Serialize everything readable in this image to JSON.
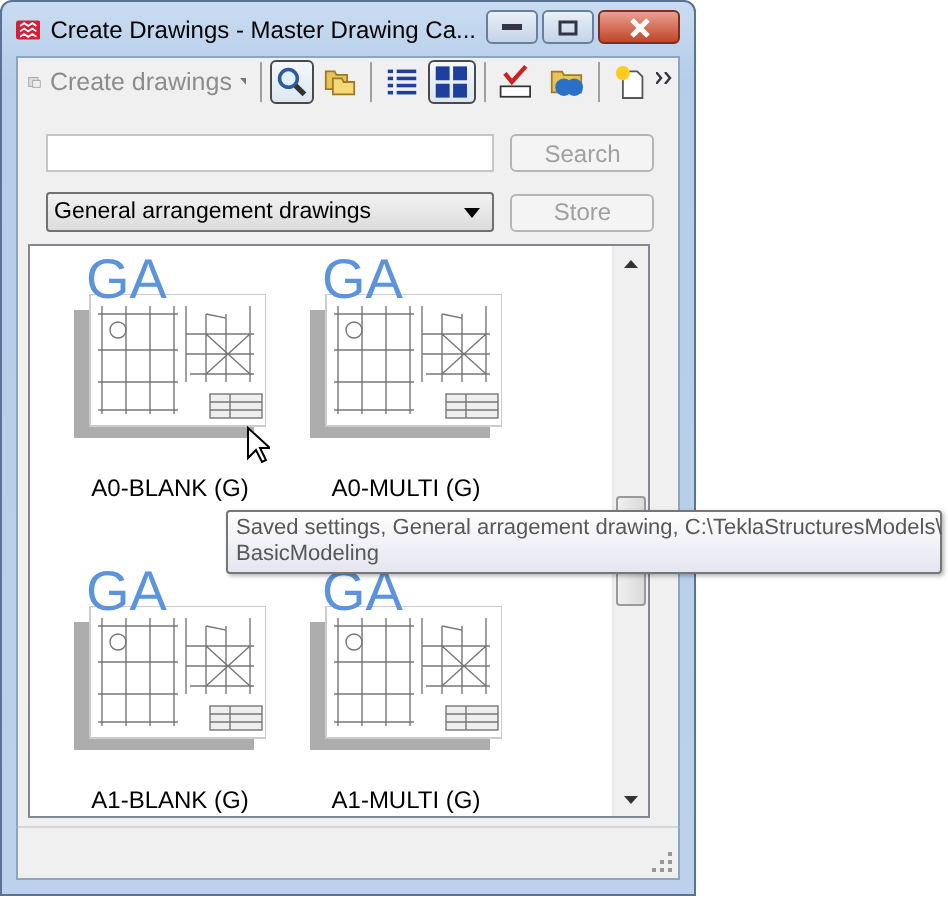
{
  "window": {
    "title": "Create Drawings - Master Drawing Ca..."
  },
  "toolbar": [
    {
      "kind": "menu",
      "label": "Create drawings",
      "disabled": true
    },
    {
      "kind": "search",
      "pressed": true
    },
    {
      "kind": "folder",
      "pressed": false
    },
    {
      "kind": "list",
      "pressed": false
    },
    {
      "kind": "grid",
      "pressed": true
    },
    {
      "kind": "spell",
      "pressed": false
    },
    {
      "kind": "globe",
      "pressed": false
    },
    {
      "kind": "new",
      "pressed": false
    }
  ],
  "search": {
    "button": "Search",
    "button_disabled": true
  },
  "filter": {
    "value": "General arrangement drawings",
    "button": "Store",
    "button_disabled": true
  },
  "tiles": [
    {
      "badge": "GA",
      "label": "A0-BLANK (G)"
    },
    {
      "badge": "GA",
      "label": "A0-MULTI (G)"
    },
    {
      "badge": "GA",
      "label": "A1-BLANK (G)"
    },
    {
      "badge": "GA",
      "label": "A1-MULTI (G)"
    }
  ],
  "tooltip": {
    "lines": [
      "Saved settings, General arragement drawing, C:\\TeklaStructuresModels\\",
      "BasicModeling"
    ]
  }
}
